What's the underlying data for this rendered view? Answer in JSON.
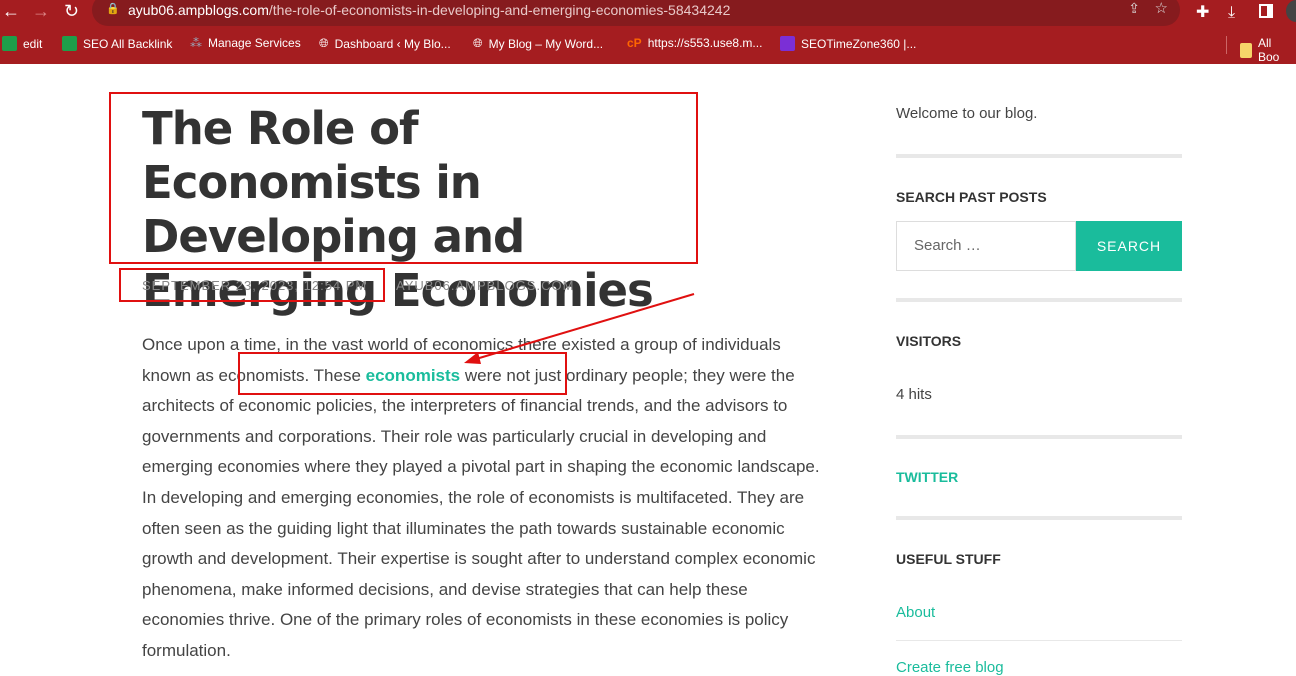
{
  "browser": {
    "url_domain": "ayub06.ampblogs.com",
    "url_path": "/the-role-of-economists-in-developing-and-emerging-economies-58434242",
    "bookmarks": [
      {
        "label": "edit"
      },
      {
        "label": "SEO All Backlink"
      },
      {
        "label": "Manage Services"
      },
      {
        "label": "Dashboard ‹ My Blo..."
      },
      {
        "label": "My Blog – My Word..."
      },
      {
        "label": "https://s553.use8.m..."
      },
      {
        "label": "SEOTimeZone360 |..."
      },
      {
        "label": "All Boo"
      }
    ]
  },
  "post": {
    "title": "The Role of Economists in Developing and Emerging Economies",
    "date": "SEPTEMBER 23, 2023, 12:54 PM",
    "author": "AYUB06.AMPBLOGS.COM",
    "body_before": "Once upon a time, in the vast world of economics there existed a group of individuals known as economists. These ",
    "body_link": "economists",
    "body_after": " were not just ordinary people; they were the architects of economic policies, the interpreters of financial trends, and the advisors to governments and corporations. Their role was particularly crucial in developing and emerging economies where they played a pivotal part in shaping the economic landscape. In developing and emerging economies, the role of economists is multifaceted. They are often seen as the guiding light that illuminates the path towards sustainable economic growth and development. Their expertise is sought after to understand complex economic phenomena, make informed decisions, and devise strategies that can help these economies thrive. One of the primary roles of economists in these economies is policy formulation."
  },
  "sidebar": {
    "welcome": "Welcome to our blog.",
    "search_heading": "SEARCH PAST POSTS",
    "search_placeholder": "Search …",
    "search_button": "SEARCH",
    "visitors_heading": "VISITORS",
    "visitors_count": "4 hits",
    "twitter": "TWITTER",
    "useful_heading": "USEFUL STUFF",
    "links": [
      "About",
      "Create free blog"
    ]
  }
}
